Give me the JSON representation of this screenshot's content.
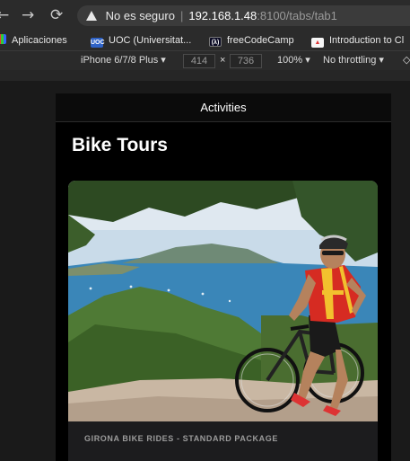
{
  "browser": {
    "not_secure": "No es seguro",
    "host": "192.168.1.48",
    "path": ":8100/tabs/tab1",
    "bookmarks": [
      {
        "label": "Aplicaciones"
      },
      {
        "label": "UOC (Universitat..."
      },
      {
        "label": "freeCodeCamp"
      },
      {
        "label": "Introduction to Cl"
      }
    ]
  },
  "devtools": {
    "device": "iPhone 6/7/8 Plus ▾",
    "width": "414",
    "times": "×",
    "height": "736",
    "zoom": "100% ▾",
    "throttle": "No throttling ▾"
  },
  "app": {
    "toolbar_title": "Activities",
    "page_title": "Bike Tours",
    "card": {
      "caption": "GIRONA BIKE RIDES - STANDARD PACKAGE"
    }
  },
  "colors": {
    "jersey_red": "#d62b22",
    "jersey_yellow": "#f2c12e",
    "sea": "#3a86b8",
    "sky": "#dfe8f0"
  }
}
